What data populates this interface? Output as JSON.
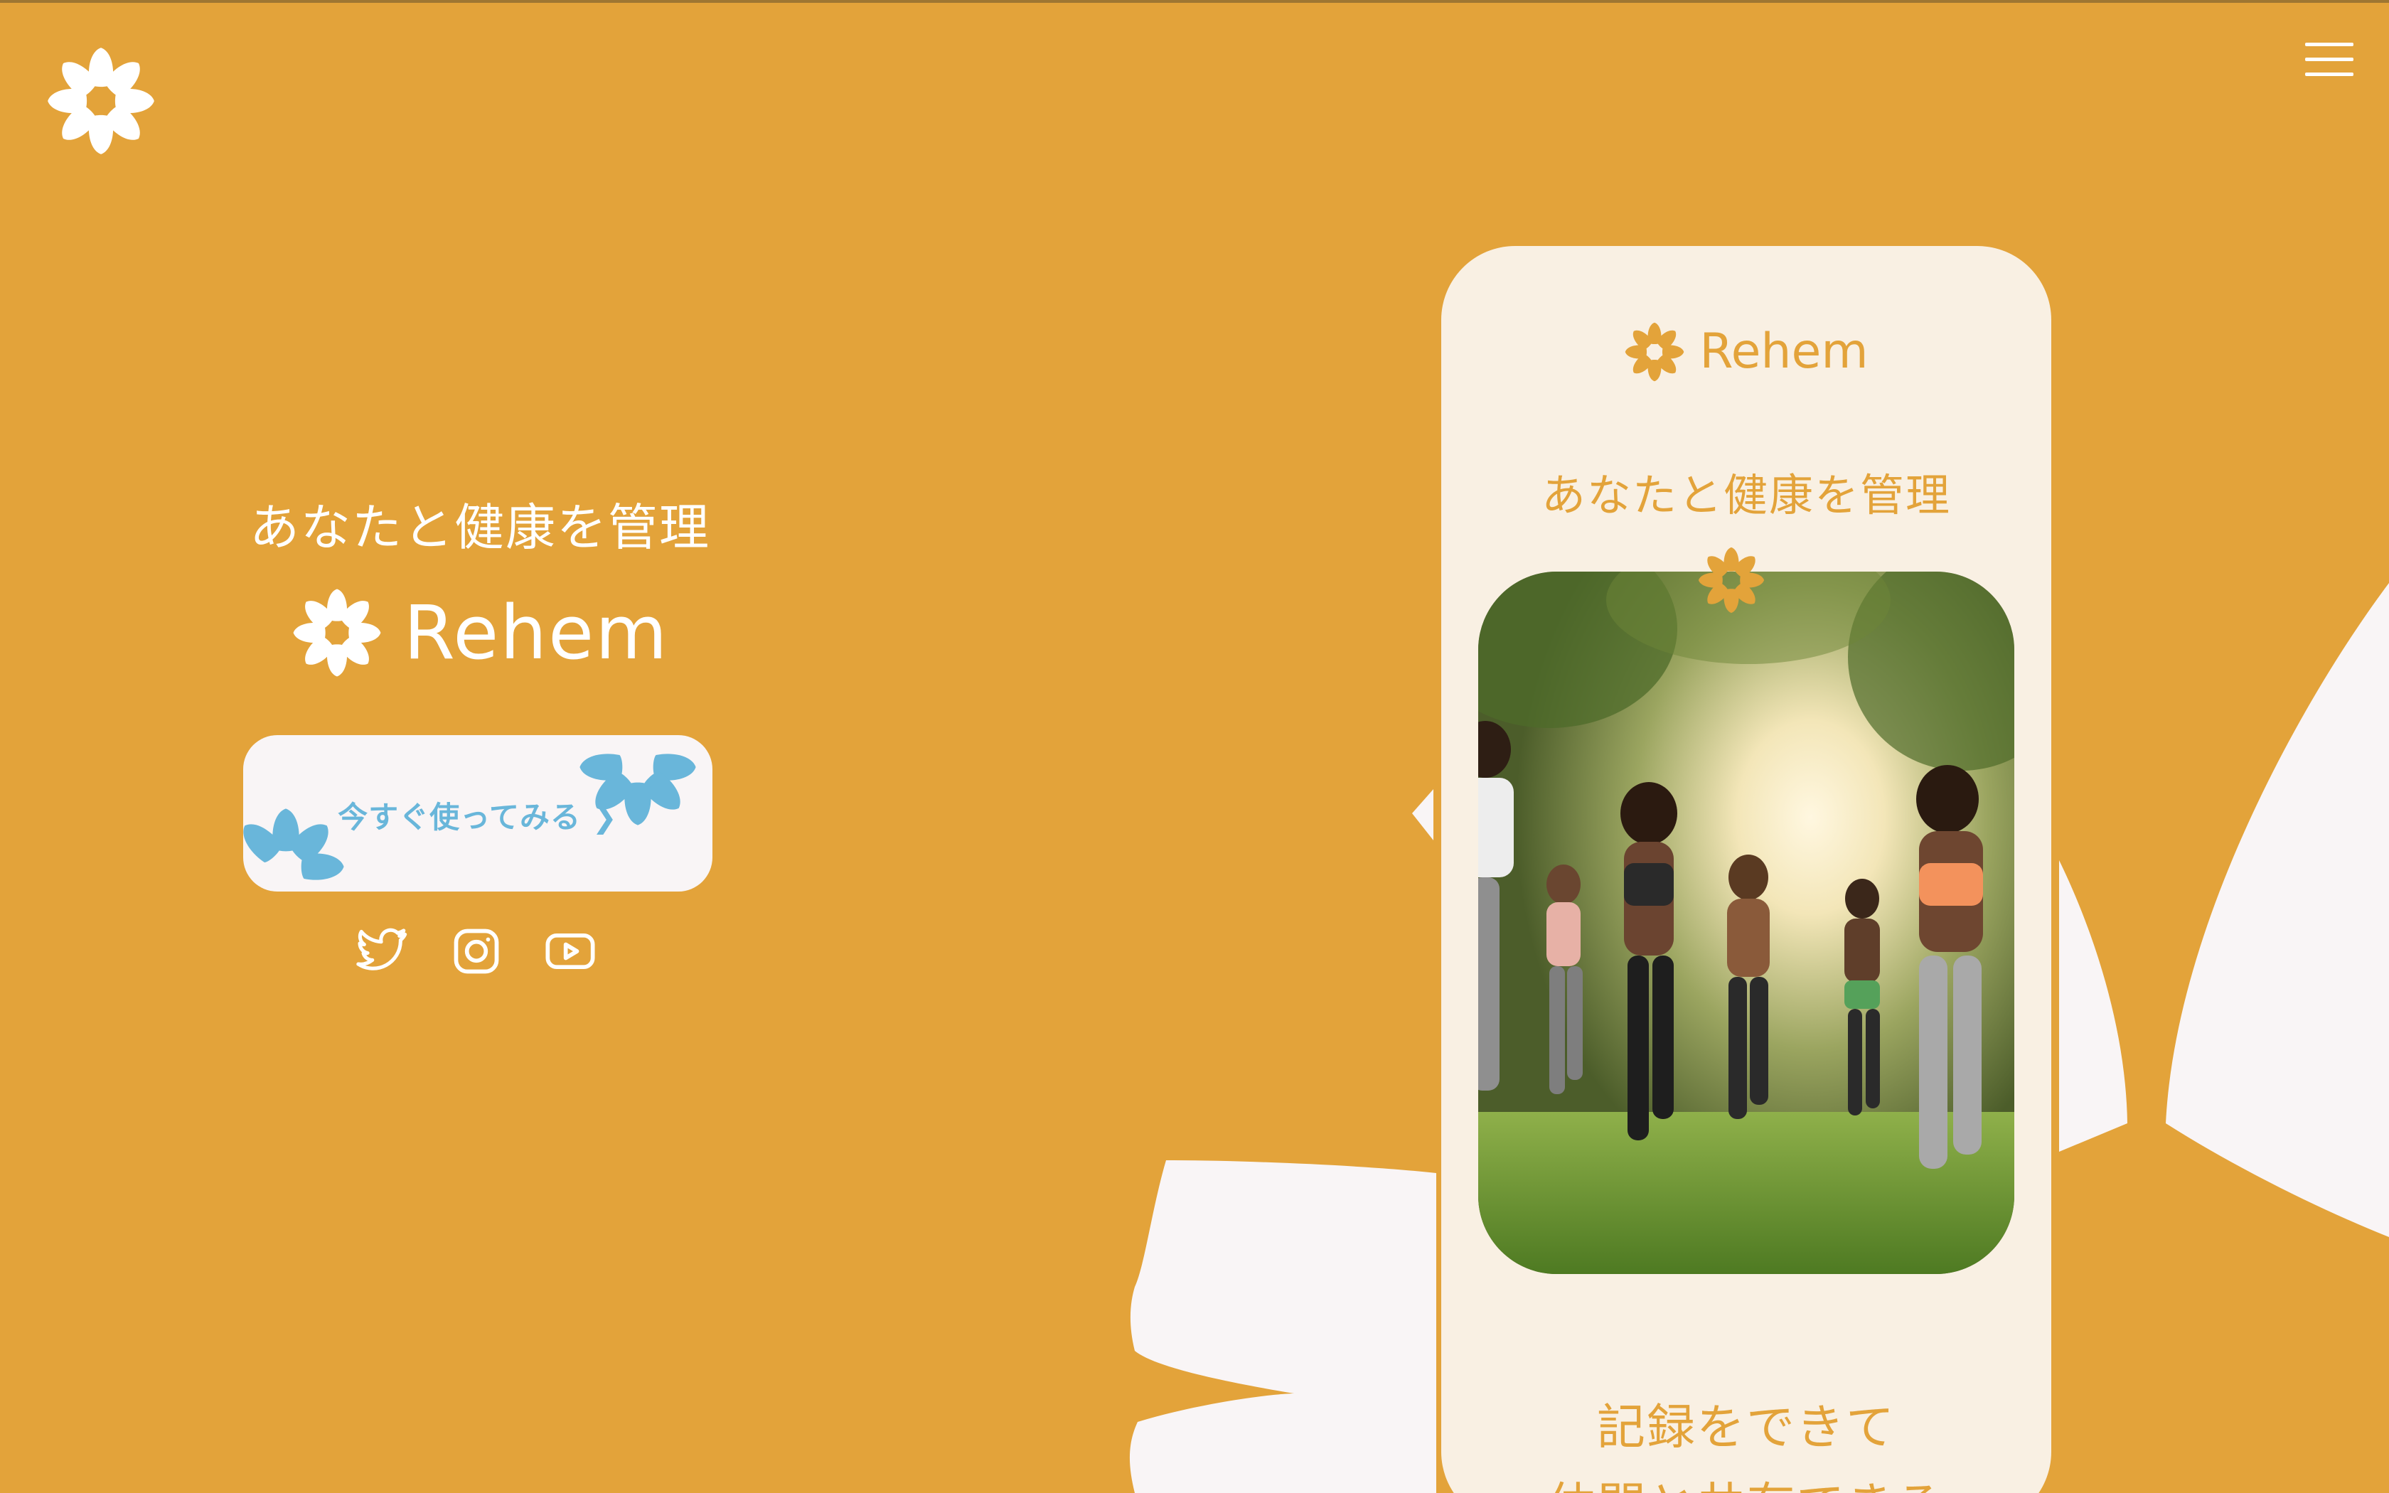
{
  "hero": {
    "tagline": "あなたと健康を管理",
    "brand": "Rehem",
    "cta_label": "今すぐ使ってみる ❯"
  },
  "phone": {
    "brand": "Rehem",
    "tagline": "あなたと健康を管理",
    "caption_line1": "記録をできて",
    "caption_line2": "仲間と共有できる"
  },
  "socials": [
    {
      "icon": "twitter-icon"
    },
    {
      "icon": "instagram-icon"
    },
    {
      "icon": "youtube-icon"
    }
  ],
  "colors": {
    "background": "#E3A33A",
    "white": "#FFFFFF",
    "cream": "#F9F0E3",
    "cta_bg": "#F9F5F6",
    "accent_blue": "#69B6DA"
  }
}
